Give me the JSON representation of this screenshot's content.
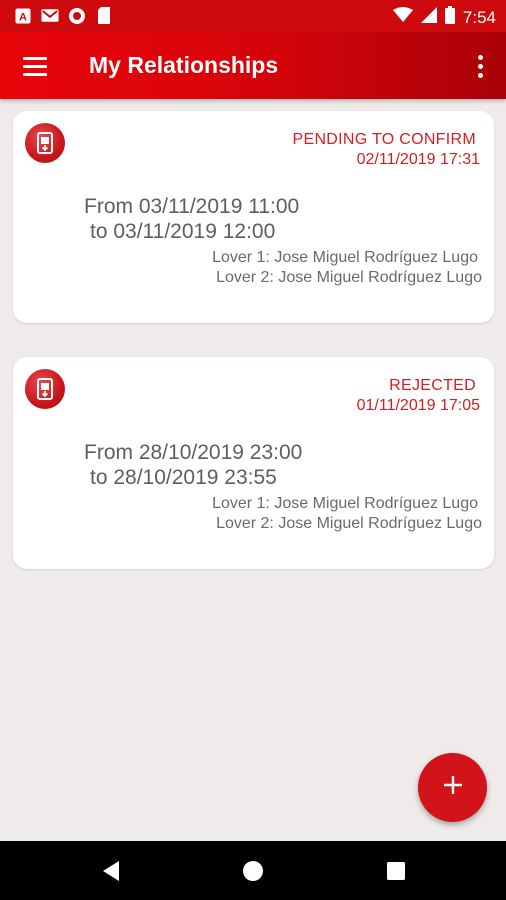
{
  "status_bar": {
    "time": "7:54",
    "left_icons": [
      "app-a-icon",
      "gmail-icon",
      "record-icon",
      "sd-card-icon"
    ],
    "right_icons": [
      "wifi-icon",
      "signal-icon",
      "battery-icon"
    ]
  },
  "app_bar": {
    "title": "My Relationships",
    "menu_icon": "hamburger-menu-icon",
    "more_icon": "more-vert-icon"
  },
  "relationships": [
    {
      "status": "PENDING TO CONFIRM",
      "status_date": "02/11/2019 17:31",
      "from": "From 03/11/2019 11:00",
      "to": "to 03/11/2019 12:00",
      "lover1": "Lover 1: Jose Miguel Rodríguez Lugo",
      "lover2": "Lover 2: Jose Miguel Rodríguez Lugo"
    },
    {
      "status": "REJECTED",
      "status_date": "01/11/2019 17:05",
      "from": "From 28/10/2019 23:00",
      "to": "to 28/10/2019 23:55",
      "lover1": "Lover 1: Jose Miguel Rodríguez Lugo",
      "lover2": "Lover 2: Jose Miguel Rodríguez Lugo"
    }
  ],
  "fab": {
    "icon": "plus-icon"
  },
  "nav_bar": {
    "icons": [
      "back-icon",
      "home-icon",
      "recents-icon"
    ]
  },
  "colors": {
    "primary": "#d1141a",
    "status_text": "#d41e22",
    "background": "#eeebea"
  }
}
